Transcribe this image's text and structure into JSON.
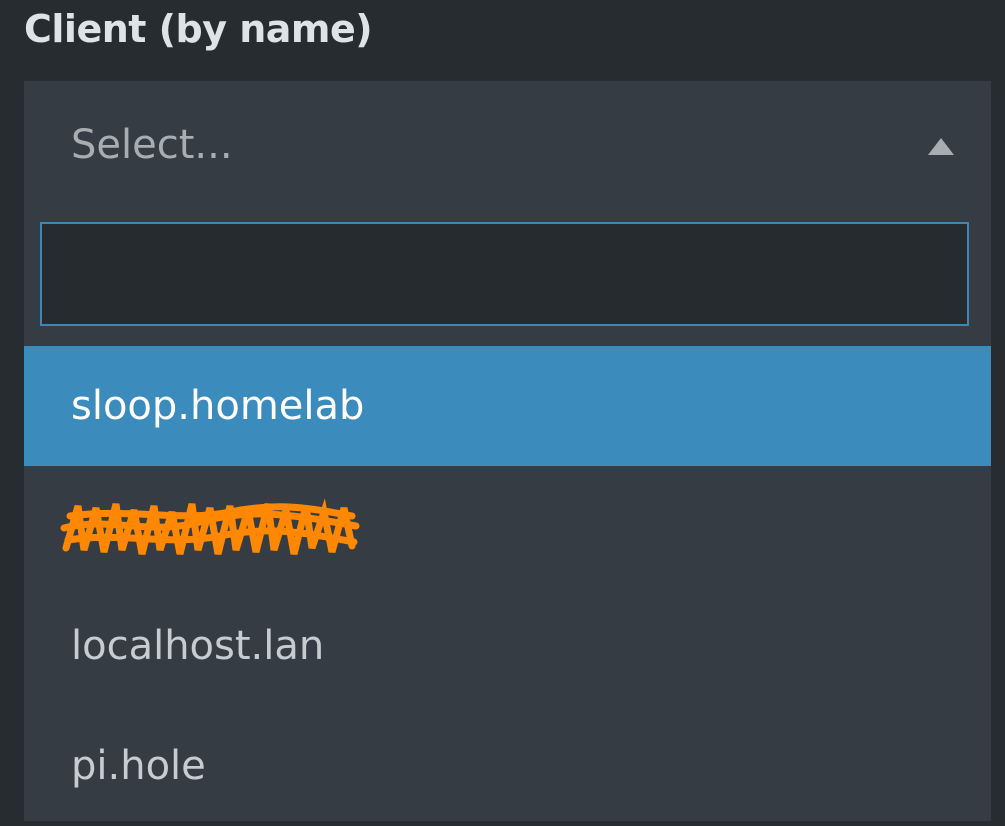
{
  "field": {
    "label": "Client (by name)"
  },
  "select": {
    "placeholder": "Select...",
    "expanded": true,
    "arrow_icon": "triangle-up-icon",
    "search_value": "",
    "options": [
      {
        "label": "sloop.homelab",
        "highlighted": true
      },
      {
        "label": "",
        "redacted": true
      },
      {
        "label": "localhost.lan",
        "highlighted": false
      },
      {
        "label": "pi.hole",
        "highlighted": false
      }
    ]
  },
  "colors": {
    "background": "#272c30",
    "panel": "#353c43",
    "input_background": "#262b30",
    "focus_border": "#3f86b4",
    "highlight": "#3b8bbd",
    "redaction": "#ff8800"
  }
}
